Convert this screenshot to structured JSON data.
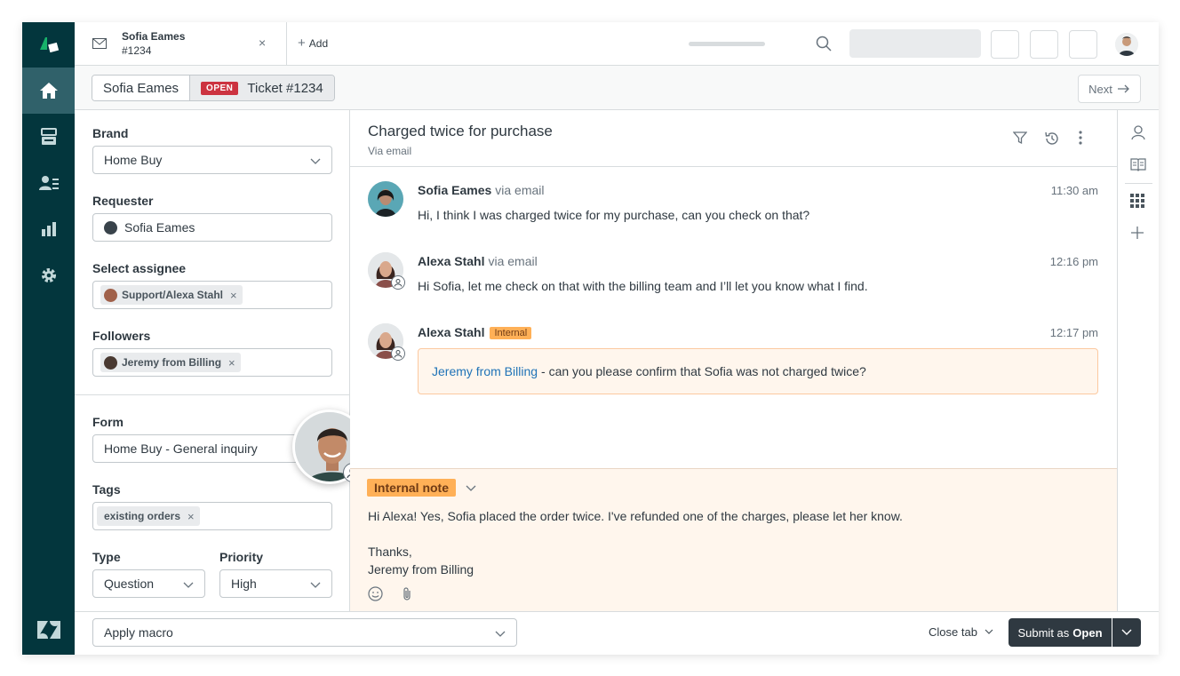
{
  "topbar": {
    "tab": {
      "title": "Sofia Eames",
      "subtitle": "#1234",
      "close": "×"
    },
    "add_label": "Add"
  },
  "subheader": {
    "requester_crumb": "Sofia Eames",
    "status_badge": "OPEN",
    "ticket_crumb": "Ticket #1234",
    "next_label": "Next"
  },
  "fields": {
    "brand": {
      "label": "Brand",
      "value": "Home Buy"
    },
    "requester": {
      "label": "Requester",
      "value": "Sofia Eames"
    },
    "assignee": {
      "label": "Select assignee",
      "value": "Support/Alexa Stahl"
    },
    "followers": {
      "label": "Followers",
      "value": "Jeremy from Billing"
    },
    "form": {
      "label": "Form",
      "value": "Home Buy - General inquiry"
    },
    "tags": {
      "label": "Tags",
      "value": "existing orders"
    },
    "type": {
      "label": "Type",
      "value": "Question"
    },
    "priority": {
      "label": "Priority",
      "value": "High"
    }
  },
  "conversation": {
    "title": "Charged twice for purchase",
    "via": "Via email",
    "messages": [
      {
        "author": "Sofia Eames",
        "via": "via email",
        "time": "11:30 am",
        "body": "Hi, I think I was charged twice for my purchase, can you check on that?"
      },
      {
        "author": "Alexa Stahl",
        "via": "via email",
        "time": "12:16 pm",
        "body": "Hi Sofia, let me check on that with the billing team and I’ll let you know what I find."
      },
      {
        "author": "Alexa Stahl",
        "tag": "Internal",
        "time": "12:17 pm",
        "mention": "Jeremy from Billing",
        "body": "- can you please confirm that Sofia was not charged twice?"
      }
    ]
  },
  "composer": {
    "mode_label": "Internal note",
    "lines": [
      "Hi Alexa! Yes, Sofia placed the order twice. I've refunded one of the charges, please let her know.",
      "",
      "Thanks,",
      "Jeremy from Billing"
    ]
  },
  "footer": {
    "macro_label": "Apply macro",
    "close_tab_label": "Close tab",
    "submit_prefix": "Submit as",
    "submit_status": "Open"
  },
  "colors": {
    "rail": "#03363d",
    "rail_active": "#30616a",
    "open_badge": "#cc3340",
    "internal_tag": "#ffb057",
    "composer_bg": "#fff6ed",
    "mention": "#1f73b7",
    "submit_bg": "#2f3941"
  }
}
